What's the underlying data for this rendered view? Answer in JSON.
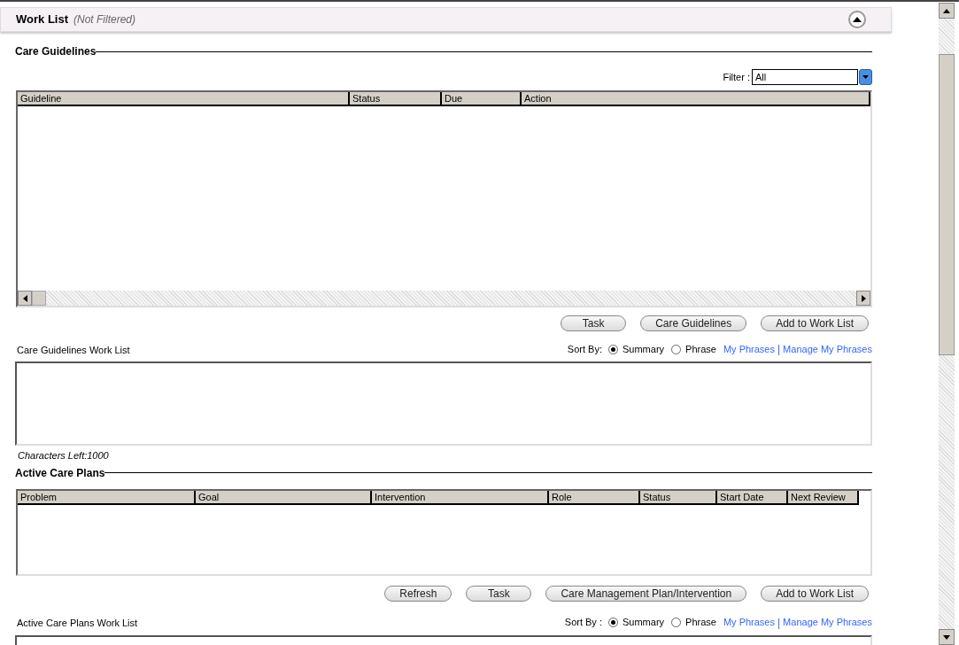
{
  "header": {
    "title": "Work List",
    "subtitle": "(Not Filtered)"
  },
  "care_guidelines": {
    "title": "Care Guidelines",
    "filter": {
      "label": "Filter :",
      "value": "All"
    },
    "table": {
      "columns": [
        "Guideline",
        "Status",
        "Due",
        "Action"
      ]
    },
    "buttons": [
      "Task",
      "Care Guidelines",
      "Add to Work List"
    ],
    "worklist": {
      "label": "Care Guidelines Work List",
      "sort_label": "Sort By:",
      "options": [
        {
          "label": "Summary",
          "selected": true
        },
        {
          "label": "Phrase",
          "selected": false
        }
      ],
      "links": [
        {
          "kind": "link",
          "text": "My Phrases"
        },
        {
          "kind": "separator",
          "text": "|"
        },
        {
          "kind": "link",
          "text": "Manage My Phrases"
        }
      ]
    },
    "characters_left": "Characters Left:1000"
  },
  "active_care_plans": {
    "title": "Active Care Plans",
    "table": {
      "columns": [
        "Problem",
        "Goal",
        "Intervention",
        "Role",
        "Status",
        "Start Date",
        "Next Review"
      ]
    },
    "buttons": [
      "Refresh",
      "Task",
      "Care Management Plan/Intervention",
      "Add to Work List"
    ],
    "worklist": {
      "label": "Active Care Plans Work List",
      "sort_label": "Sort By :",
      "options": [
        {
          "label": "Summary",
          "selected": true
        },
        {
          "label": "Phrase",
          "selected": false
        }
      ],
      "links": [
        {
          "kind": "link",
          "text": "My Phrases"
        },
        {
          "kind": "separator",
          "text": "|"
        },
        {
          "kind": "link",
          "text": "Manage My Phrases"
        }
      ]
    }
  }
}
